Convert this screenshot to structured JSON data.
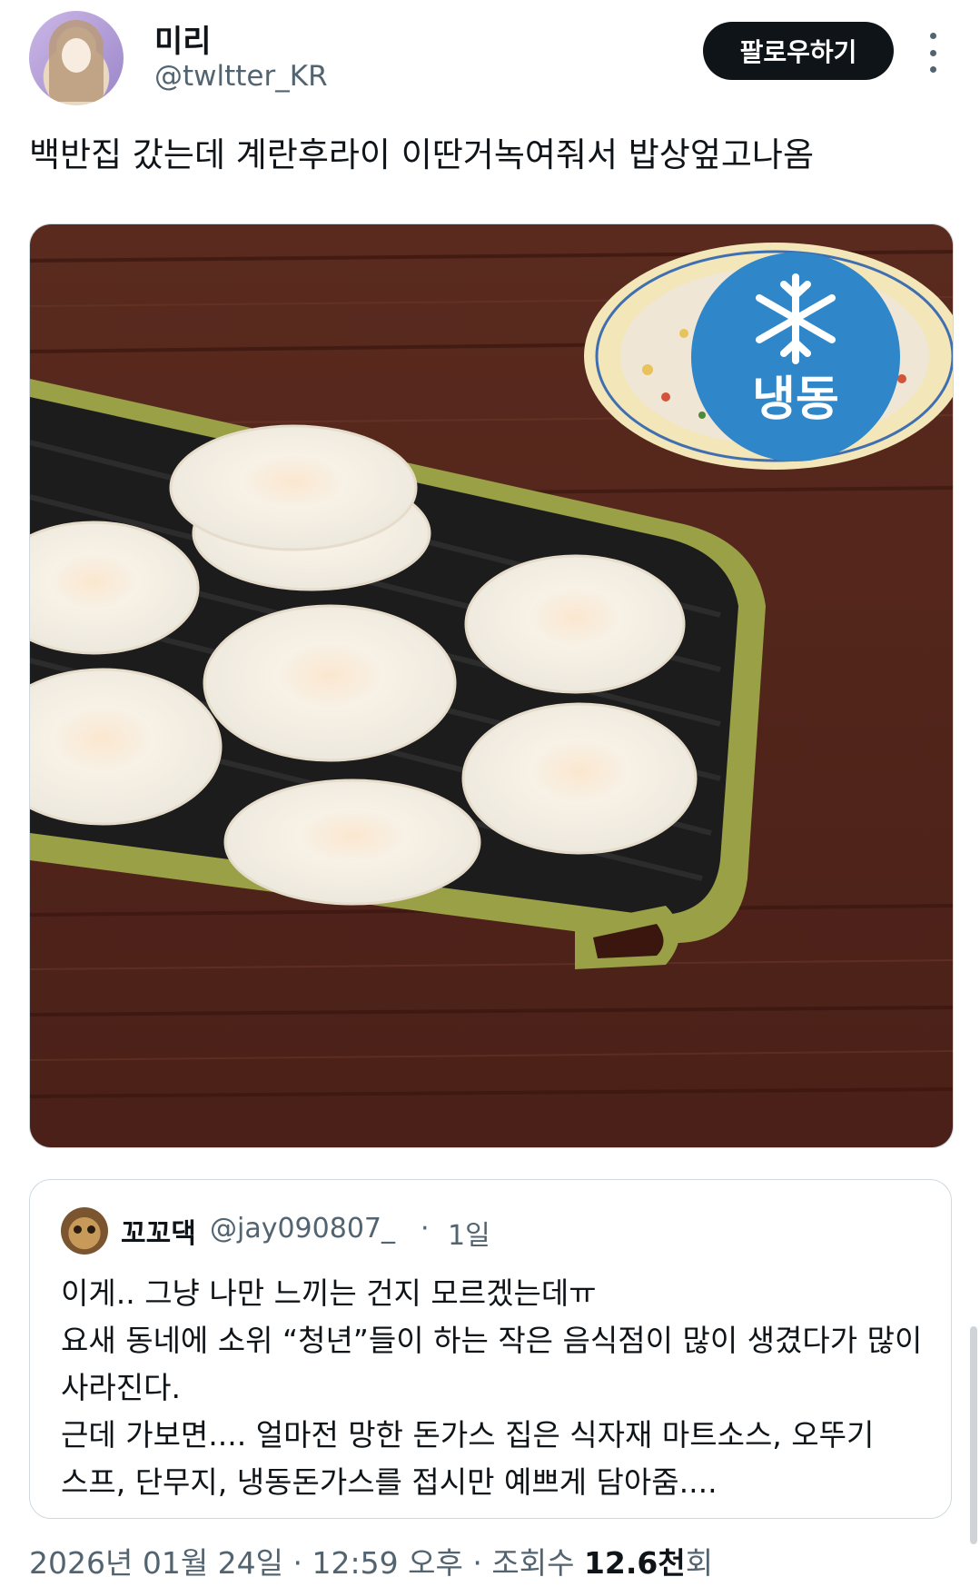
{
  "author": {
    "name": "미리",
    "handle": "@twltter_KR"
  },
  "actions": {
    "follow_label": "팔로우하기",
    "more_icon": "more-dots-icon"
  },
  "tweet": {
    "text": "백반집 갔는데 계란후라이 이딴거녹여줘서 밥상엎고나옴"
  },
  "media": {
    "badge_text": "냉동",
    "badge_icon": "snowflake-icon",
    "badge_color": "#2f86c8"
  },
  "quote": {
    "name": "꼬꼬댁",
    "handle": "@jay090807_",
    "separator": "·",
    "time": "1일",
    "lines": [
      "이게.. 그냥 나만 느끼는 건지 모르겠는데ㅠ",
      "요새 동네에 소위 “청년”들이 하는 작은 음식점이 많이 생겼다가 많이",
      "사라진다.",
      "근데 가보면.... 얼마전 망한 돈가스 집은 식자재 마트소스, 오뚜기",
      "스프, 단무지, 냉동돈가스를 접시만 예쁘게 담아줌...."
    ]
  },
  "meta": {
    "date": "2026년 01월 24일",
    "sep": "·",
    "time": "12:59 오후",
    "views_label": "조회수",
    "views_count": "12.6천",
    "views_suffix": "회"
  }
}
